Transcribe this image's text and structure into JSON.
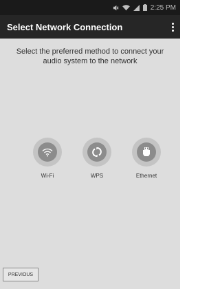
{
  "status_bar": {
    "time": "2:25 PM",
    "icons": [
      "mute-icon",
      "wifi-signal-icon",
      "cell-signal-icon",
      "battery-icon"
    ]
  },
  "app_bar": {
    "title": "Select Network Connection",
    "menu_icon": "overflow-menu-icon"
  },
  "main": {
    "instruction": "Select the preferred method to connect your audio system to the network",
    "options": [
      {
        "label": "Wi-Fi",
        "icon": "wifi-icon"
      },
      {
        "label": "WPS",
        "icon": "wps-icon"
      },
      {
        "label": "Ethernet",
        "icon": "ethernet-icon"
      }
    ]
  },
  "footer": {
    "previous_label": "PREVIOUS"
  },
  "colors": {
    "status_bar_bg": "#1a1a1a",
    "app_bar_bg": "#262626",
    "content_bg": "#dddddd",
    "option_disc": "#8c8c8c",
    "option_halo": "#c4c4c4"
  }
}
